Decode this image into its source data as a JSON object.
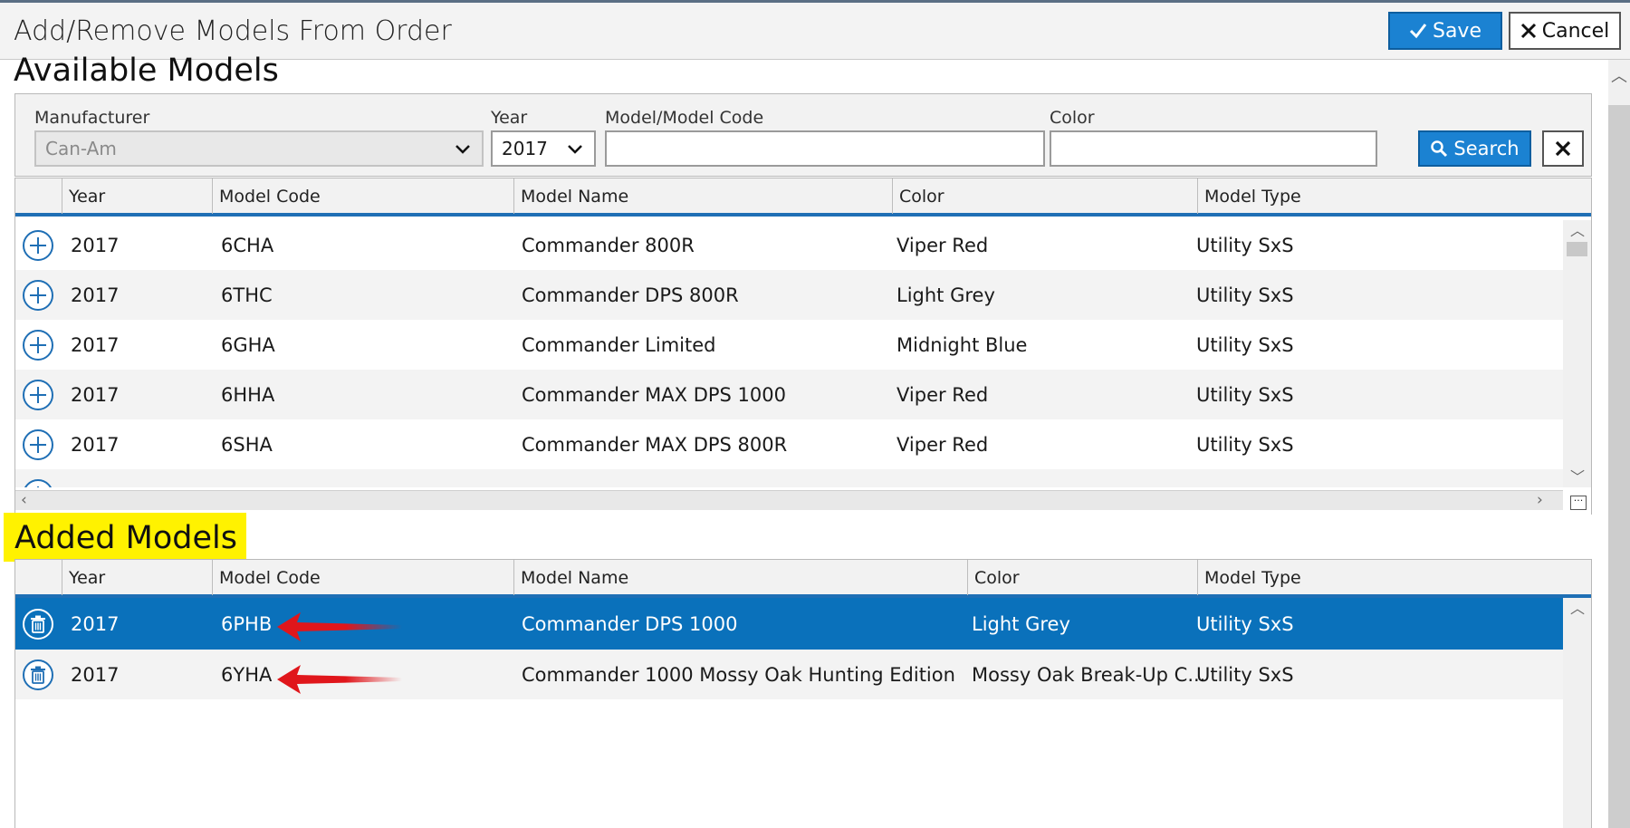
{
  "window": {
    "title": "Add/Remove Models From Order",
    "save_label": "Save",
    "cancel_label": "Cancel"
  },
  "available": {
    "title": "Available Models",
    "filters": {
      "manufacturer_label": "Manufacturer",
      "manufacturer_value": "Can-Am",
      "year_label": "Year",
      "year_value": "2017",
      "model_label": "Model/Model Code",
      "model_value": "",
      "color_label": "Color",
      "color_value": "",
      "search_label": "Search"
    },
    "columns": [
      "Year",
      "Model Code",
      "Model Name",
      "Color",
      "Model Type"
    ],
    "rows": [
      {
        "year": "2017",
        "code": "6CHA",
        "name": "Commander 800R",
        "color": "Viper Red",
        "type": "Utility SxS"
      },
      {
        "year": "2017",
        "code": "6THC",
        "name": "Commander DPS 800R",
        "color": "Light Grey",
        "type": "Utility SxS"
      },
      {
        "year": "2017",
        "code": "6GHA",
        "name": "Commander Limited",
        "color": "Midnight Blue",
        "type": "Utility SxS"
      },
      {
        "year": "2017",
        "code": "6HHA",
        "name": "Commander MAX DPS 1000",
        "color": "Viper Red",
        "type": "Utility SxS"
      },
      {
        "year": "2017",
        "code": "6SHA",
        "name": "Commander MAX DPS 800R",
        "color": "Viper Red",
        "type": "Utility SxS"
      }
    ]
  },
  "added": {
    "title": "Added Models",
    "columns": [
      "Year",
      "Model Code",
      "Model Name",
      "Color",
      "Model Type"
    ],
    "rows": [
      {
        "year": "2017",
        "code": "6PHB",
        "name": "Commander DPS 1000",
        "color": "Light Grey",
        "type": "Utility SxS",
        "selected": true
      },
      {
        "year": "2017",
        "code": "6YHA",
        "name": "Commander 1000 Mossy Oak Hunting Edition",
        "color": "Mossy Oak Break-Up C...",
        "type": "Utility SxS",
        "selected": false
      }
    ]
  },
  "colors": {
    "accent": "#1b82d2",
    "selected_row": "#0a71bb",
    "highlight": "#fff200",
    "annotation_arrow": "#e0161b"
  },
  "icons": {
    "add_row": "plus-circle-icon",
    "remove_row": "trash-icon",
    "save": "checkmark-icon",
    "cancel": "close-icon",
    "search": "search-icon"
  }
}
